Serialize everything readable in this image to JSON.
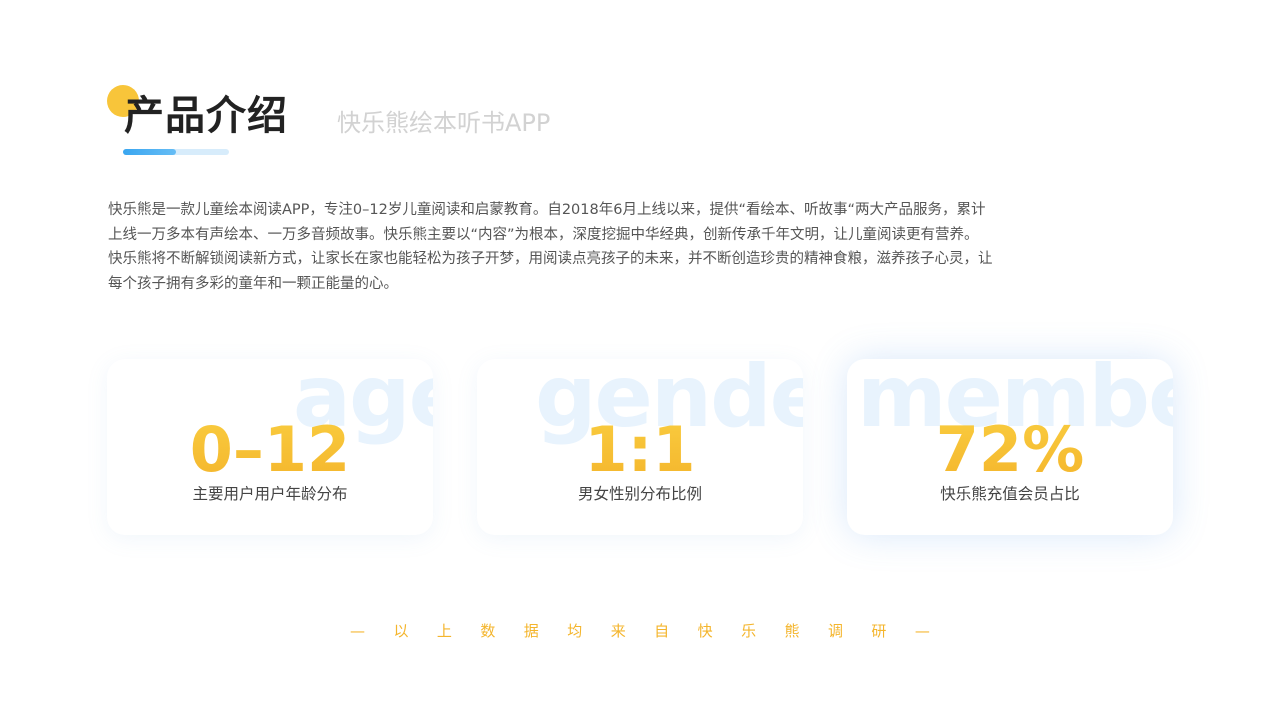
{
  "header": {
    "title": "产品介绍",
    "subtitle": "快乐熊绘本听书APP"
  },
  "intro": {
    "lines": [
      "快乐熊是一款儿童绘本阅读APP，专注0–12岁儿童阅读和启蒙教育。自2018年6月上线以来，提供“看绘本、听故事“两大产品服务，累计",
      "上线一万多本有声绘本、一万多音频故事。快乐熊主要以“内容”为根本，深度挖掘中华经典，创新传承千年文明，让儿童阅读更有营养。",
      "快乐熊将不断解锁阅读新方式，让家长在家也能轻松为孩子开梦，用阅读点亮孩子的未来，并不断创造珍贵的精神食粮，滋养孩子心灵，让",
      "每个孩子拥有多彩的童年和一颗正能量的心。"
    ]
  },
  "stats": [
    {
      "bg": "age",
      "value": "0–12",
      "label": "主要用户用户年龄分布"
    },
    {
      "bg": "gender",
      "value": "1:1",
      "label": "男女性别分布比例"
    },
    {
      "bg": "member",
      "value": "72%",
      "label": "快乐熊充值会员占比"
    }
  ],
  "footer": {
    "chars": [
      "—",
      "以",
      "上",
      "数",
      "据",
      "均",
      "来",
      "自",
      "快",
      "乐",
      "熊",
      "调",
      "研",
      "—"
    ]
  },
  "colors": {
    "accent_yellow": "#f4b52c",
    "accent_blue": "#3aa6f0",
    "title_dot": "#f8c53a"
  }
}
